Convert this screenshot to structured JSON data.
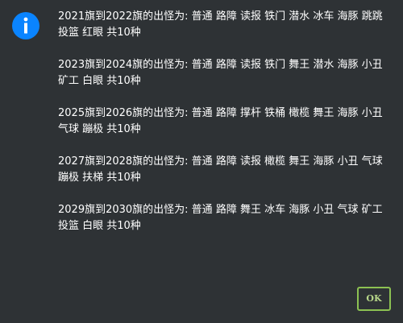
{
  "dialog": {
    "icon": "info-icon",
    "accent_color": "#0a84ff",
    "background_color": "#2e3235",
    "messages": [
      "2021旗到2022旗的出怪为: 普通 路障 读报 铁门 潜水 冰车 海豚 跳跳 投篮 红眼 共10种",
      "2023旗到2024旗的出怪为: 普通 路障 读报 铁门 舞王 潜水 海豚 小丑 矿工 白眼 共10种",
      "2025旗到2026旗的出怪为: 普通 路障 撑杆 铁桶 橄榄 舞王 海豚 小丑 气球 蹦极 共10种",
      "2027旗到2028旗的出怪为: 普通 路障 读报 橄榄 舞王 海豚 小丑 气球 蹦极 扶梯 共10种",
      "2029旗到2030旗的出怪为: 普通 路障 舞王 冰车 海豚 小丑 气球 矿工 投篮 白眼 共10种"
    ],
    "ok_label": "OK",
    "ok_border_color": "#8cc152"
  }
}
